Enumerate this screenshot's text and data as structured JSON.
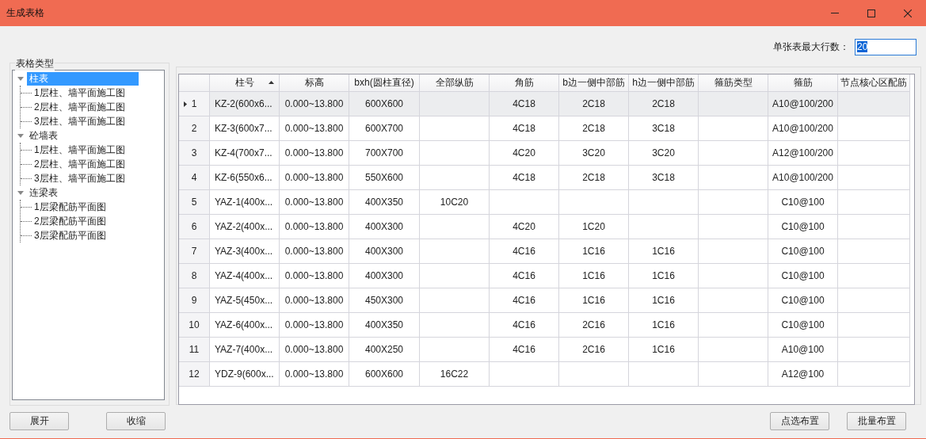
{
  "window": {
    "title": "生成表格"
  },
  "max_rows": {
    "label": "单张表最大行数：",
    "value": "20",
    "text_selected": true
  },
  "tree": {
    "title": "表格类型",
    "items": [
      {
        "label": "柱表",
        "selected": true,
        "expanded": true,
        "children": [
          {
            "label": "1层柱、墙平面施工图",
            "selected": false
          },
          {
            "label": "2层柱、墙平面施工图",
            "selected": false
          },
          {
            "label": "3层柱、墙平面施工图",
            "selected": false
          }
        ]
      },
      {
        "label": "砼墙表",
        "selected": false,
        "expanded": true,
        "children": [
          {
            "label": "1层柱、墙平面施工图",
            "selected": false
          },
          {
            "label": "2层柱、墙平面施工图",
            "selected": false
          },
          {
            "label": "3层柱、墙平面施工图",
            "selected": false
          }
        ]
      },
      {
        "label": "连梁表",
        "selected": false,
        "expanded": true,
        "children": [
          {
            "label": "1层梁配筋平面图",
            "selected": false
          },
          {
            "label": "2层梁配筋平面图",
            "selected": false
          },
          {
            "label": "3层梁配筋平面图",
            "selected": false
          }
        ]
      }
    ]
  },
  "table": {
    "columns": [
      {
        "label": "柱号",
        "sorted": true
      },
      {
        "label": "标高",
        "sorted": false
      },
      {
        "label": "bxh(圆柱直径)",
        "sorted": false
      },
      {
        "label": "全部纵筋",
        "sorted": false
      },
      {
        "label": "角筋",
        "sorted": false
      },
      {
        "label": "b边一侧中部筋",
        "sorted": false
      },
      {
        "label": "h边一侧中部筋",
        "sorted": false
      },
      {
        "label": "箍筋类型",
        "sorted": false
      },
      {
        "label": "箍筋",
        "sorted": false
      },
      {
        "label": "节点核心区配筋",
        "sorted": false
      }
    ],
    "rows": [
      {
        "no": "1",
        "selected": true,
        "cells": [
          "KZ-2(600x6...",
          "0.000~13.800",
          "600X600",
          null,
          "4C18",
          "2C18",
          "2C18",
          null,
          "A10@100/200",
          null
        ]
      },
      {
        "no": "2",
        "selected": false,
        "cells": [
          "KZ-3(600x7...",
          "0.000~13.800",
          "600X700",
          null,
          "4C18",
          "2C18",
          "3C18",
          null,
          "A10@100/200",
          null
        ]
      },
      {
        "no": "3",
        "selected": false,
        "cells": [
          "KZ-4(700x7...",
          "0.000~13.800",
          "700X700",
          null,
          "4C20",
          "3C20",
          "3C20",
          null,
          "A12@100/200",
          null
        ]
      },
      {
        "no": "4",
        "selected": false,
        "cells": [
          "KZ-6(550x6...",
          "0.000~13.800",
          "550X600",
          null,
          "4C18",
          "2C18",
          "3C18",
          null,
          "A10@100/200",
          null
        ]
      },
      {
        "no": "5",
        "selected": false,
        "cells": [
          "YAZ-1(400x...",
          "0.000~13.800",
          "400X350",
          "10C20",
          null,
          null,
          null,
          null,
          "C10@100",
          null
        ]
      },
      {
        "no": "6",
        "selected": false,
        "cells": [
          "YAZ-2(400x...",
          "0.000~13.800",
          "400X300",
          null,
          "4C20",
          "1C20",
          null,
          null,
          "C10@100",
          null
        ]
      },
      {
        "no": "7",
        "selected": false,
        "cells": [
          "YAZ-3(400x...",
          "0.000~13.800",
          "400X300",
          null,
          "4C16",
          "1C16",
          "1C16",
          null,
          "C10@100",
          null
        ]
      },
      {
        "no": "8",
        "selected": false,
        "cells": [
          "YAZ-4(400x...",
          "0.000~13.800",
          "400X300",
          null,
          "4C16",
          "1C16",
          "1C16",
          null,
          "C10@100",
          null
        ]
      },
      {
        "no": "9",
        "selected": false,
        "cells": [
          "YAZ-5(450x...",
          "0.000~13.800",
          "450X300",
          null,
          "4C16",
          "1C16",
          "1C16",
          null,
          "C10@100",
          null
        ]
      },
      {
        "no": "10",
        "selected": false,
        "cells": [
          "YAZ-6(400x...",
          "0.000~13.800",
          "400X350",
          null,
          "4C16",
          "2C16",
          "1C16",
          null,
          "C10@100",
          null
        ]
      },
      {
        "no": "11",
        "selected": false,
        "cells": [
          "YAZ-7(400x...",
          "0.000~13.800",
          "400X250",
          null,
          "4C16",
          "2C16",
          "1C16",
          null,
          "A10@100",
          null
        ]
      },
      {
        "no": "12",
        "selected": false,
        "cells": [
          "YDZ-9(600x...",
          "0.000~13.800",
          "600X600",
          "16C22",
          null,
          null,
          null,
          null,
          "A12@100",
          null
        ]
      }
    ]
  },
  "left_buttons": [
    "展开",
    "收缩"
  ],
  "right_buttons": [
    "点选布置",
    "批量布置"
  ]
}
